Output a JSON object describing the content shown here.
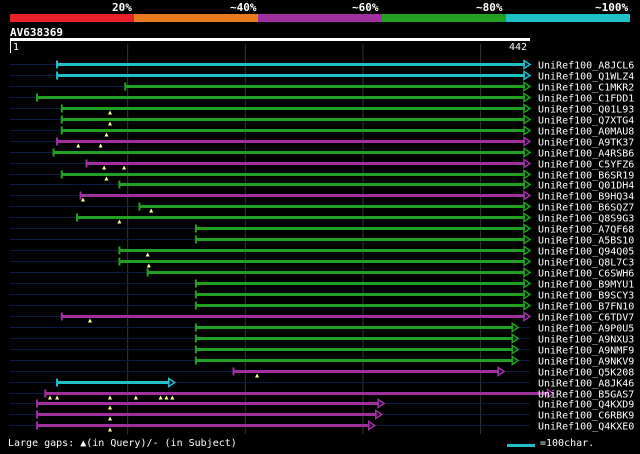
{
  "scale": {
    "colors": [
      "#e8202a",
      "#e87a20",
      "#a030a0",
      "#22a022",
      "#20c0c8"
    ],
    "labels": [
      "20%",
      "~40%",
      "~60%",
      "~80%",
      "~100%"
    ]
  },
  "query": {
    "name": "AV638369",
    "start": "1",
    "end": "442"
  },
  "footer": {
    "left_text": "Large gaps: ▲(in Query)/- (in Subject)",
    "right_text": "=100char."
  },
  "hits": [
    {
      "label": "UniRef100_A8JCL6",
      "color": "#20c0c8",
      "start": 40,
      "end": 442,
      "gaps": []
    },
    {
      "label": "UniRef100_Q1WLZ4",
      "color": "#20c0c8",
      "start": 40,
      "end": 442,
      "gaps": []
    },
    {
      "label": "UniRef100_C1MKR2",
      "color": "#22a022",
      "start": 98,
      "end": 442,
      "gaps": []
    },
    {
      "label": "UniRef100_C1FDD1",
      "color": "#22a022",
      "start": 23,
      "end": 442,
      "gaps": []
    },
    {
      "label": "UniRef100_Q01L93",
      "color": "#22a022",
      "start": 44,
      "end": 442,
      "gaps": [
        85
      ]
    },
    {
      "label": "UniRef100_Q7XTG4",
      "color": "#22a022",
      "start": 44,
      "end": 442,
      "gaps": [
        85
      ]
    },
    {
      "label": "UniRef100_A0MAU8",
      "color": "#22a022",
      "start": 44,
      "end": 442,
      "gaps": [
        82
      ]
    },
    {
      "label": "UniRef100_A9TK37",
      "color": "#a030a0",
      "start": 40,
      "end": 442,
      "gaps": [
        58,
        77
      ]
    },
    {
      "label": "UniRef100_A4RSB6",
      "color": "#22a022",
      "start": 37,
      "end": 442,
      "gaps": []
    },
    {
      "label": "UniRef100_C5YFZ6",
      "color": "#a030a0",
      "start": 65,
      "end": 442,
      "gaps": [
        80,
        97
      ]
    },
    {
      "label": "UniRef100_B6SR19",
      "color": "#22a022",
      "start": 44,
      "end": 442,
      "gaps": [
        82
      ]
    },
    {
      "label": "UniRef100_Q01DH4",
      "color": "#22a022",
      "start": 93,
      "end": 442,
      "gaps": []
    },
    {
      "label": "UniRef100_B9HQ34",
      "color": "#a030a0",
      "start": 60,
      "end": 442,
      "gaps": [
        62
      ]
    },
    {
      "label": "UniRef100_B6SQZ7",
      "color": "#22a022",
      "start": 110,
      "end": 442,
      "gaps": [
        120
      ]
    },
    {
      "label": "UniRef100_Q8S9G3",
      "color": "#22a022",
      "start": 57,
      "end": 442,
      "gaps": [
        93
      ]
    },
    {
      "label": "UniRef100_A7QF68",
      "color": "#22a022",
      "start": 158,
      "end": 442,
      "gaps": []
    },
    {
      "label": "UniRef100_A5BS10",
      "color": "#22a022",
      "start": 158,
      "end": 442,
      "gaps": []
    },
    {
      "label": "UniRef100_Q94Q05",
      "color": "#22a022",
      "start": 93,
      "end": 442,
      "gaps": [
        117
      ]
    },
    {
      "label": "UniRef100_Q8L7C3",
      "color": "#22a022",
      "start": 93,
      "end": 442,
      "gaps": [
        118
      ]
    },
    {
      "label": "UniRef100_C6SWH6",
      "color": "#22a022",
      "start": 117,
      "end": 442,
      "gaps": []
    },
    {
      "label": "UniRef100_B9MYU1",
      "color": "#22a022",
      "start": 158,
      "end": 442,
      "gaps": []
    },
    {
      "label": "UniRef100_B9SCY3",
      "color": "#22a022",
      "start": 158,
      "end": 442,
      "gaps": []
    },
    {
      "label": "UniRef100_B7FN10",
      "color": "#22a022",
      "start": 158,
      "end": 442,
      "gaps": []
    },
    {
      "label": "UniRef100_C6TDV7",
      "color": "#a030a0",
      "start": 44,
      "end": 442,
      "gaps": [
        68
      ]
    },
    {
      "label": "UniRef100_A9P0U5",
      "color": "#22a022",
      "start": 158,
      "end": 432,
      "gaps": []
    },
    {
      "label": "UniRef100_A9NXU3",
      "color": "#22a022",
      "start": 158,
      "end": 432,
      "gaps": []
    },
    {
      "label": "UniRef100_A9NMF9",
      "color": "#22a022",
      "start": 158,
      "end": 432,
      "gaps": []
    },
    {
      "label": "UniRef100_A9NKV9",
      "color": "#22a022",
      "start": 158,
      "end": 432,
      "gaps": []
    },
    {
      "label": "UniRef100_Q5K208",
      "color": "#a030a0",
      "start": 190,
      "end": 420,
      "gaps": [
        210
      ]
    },
    {
      "label": "UniRef100_A8JK46",
      "color": "#20c0c8",
      "start": 40,
      "end": 140,
      "gaps": []
    },
    {
      "label": "UniRef100_B5GAS7",
      "color": "#a030a0",
      "start": 30,
      "end": 462,
      "gaps": [
        34,
        40,
        85,
        107,
        128,
        133,
        138
      ]
    },
    {
      "label": "UniRef100_Q4KXD9",
      "color": "#a030a0",
      "start": 23,
      "end": 318,
      "gaps": [
        85
      ]
    },
    {
      "label": "UniRef100_C6RBK9",
      "color": "#a030a0",
      "start": 23,
      "end": 316,
      "gaps": [
        85
      ]
    },
    {
      "label": "UniRef100_Q4KXE0",
      "color": "#a030a0",
      "start": 23,
      "end": 310,
      "gaps": [
        85
      ]
    }
  ]
}
